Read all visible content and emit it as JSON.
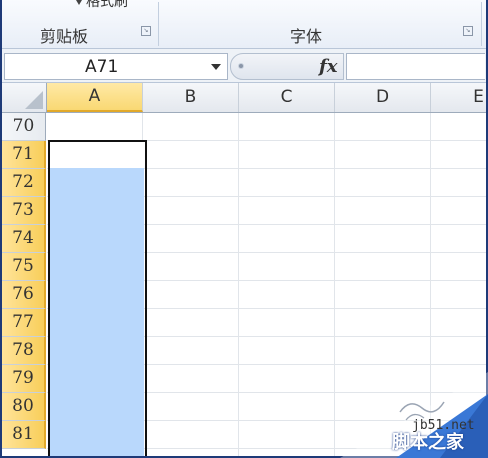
{
  "ribbon": {
    "partial_label": "格式刷",
    "groups": [
      {
        "label": "剪贴板"
      },
      {
        "label": "字体"
      }
    ],
    "launcher_icon": "dialog-launcher-icon"
  },
  "formula_bar": {
    "name_box_value": "A71",
    "fx_label": "fx",
    "formula_value": ""
  },
  "grid": {
    "columns": [
      "A",
      "B",
      "C",
      "D",
      "E"
    ],
    "selected_column": "A",
    "rows": [
      "70",
      "71",
      "72",
      "73",
      "74",
      "75",
      "76",
      "77",
      "78",
      "79",
      "80",
      "81"
    ],
    "selected_rows": [
      "71",
      "72",
      "73",
      "74",
      "75",
      "76",
      "77",
      "78",
      "79",
      "80",
      "81"
    ],
    "active_cell": "A71",
    "selection_color": "#b9d8fc"
  },
  "watermark": {
    "site": "jb51.net",
    "brand": "脚本之家"
  }
}
